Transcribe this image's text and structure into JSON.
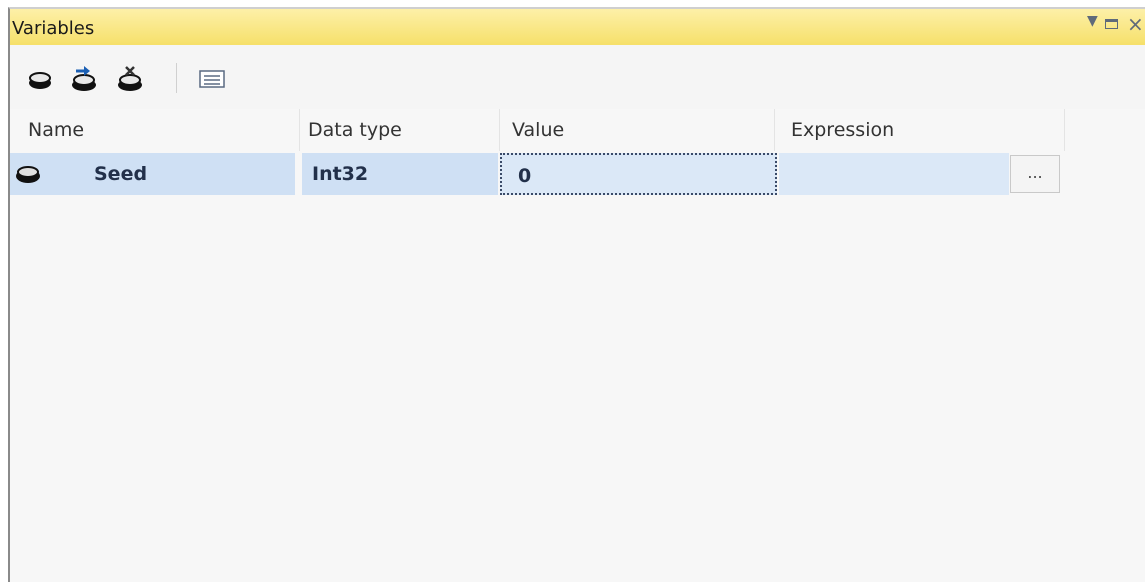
{
  "window": {
    "title": "Variables",
    "controls": [
      "dropdown-icon",
      "maximize-icon",
      "close-icon"
    ]
  },
  "toolbar": {
    "buttons": [
      {
        "name": "add-variable-button",
        "icon": "add-variable-icon"
      },
      {
        "name": "move-variable-button",
        "icon": "move-variable-icon"
      },
      {
        "name": "delete-variable-button",
        "icon": "delete-variable-icon"
      },
      {
        "name": "grid-options-button",
        "icon": "grid-options-icon"
      }
    ]
  },
  "grid": {
    "columns": [
      "Name",
      "Data type",
      "Value",
      "Expression"
    ],
    "rows": [
      {
        "name": "Seed",
        "data_type": "Int32",
        "value": "0",
        "expression": "",
        "expression_button": "...",
        "icon": "variable-icon"
      }
    ]
  },
  "colors": {
    "title_bar": "#f6e06a",
    "selected_row": "#cfe0f4"
  }
}
